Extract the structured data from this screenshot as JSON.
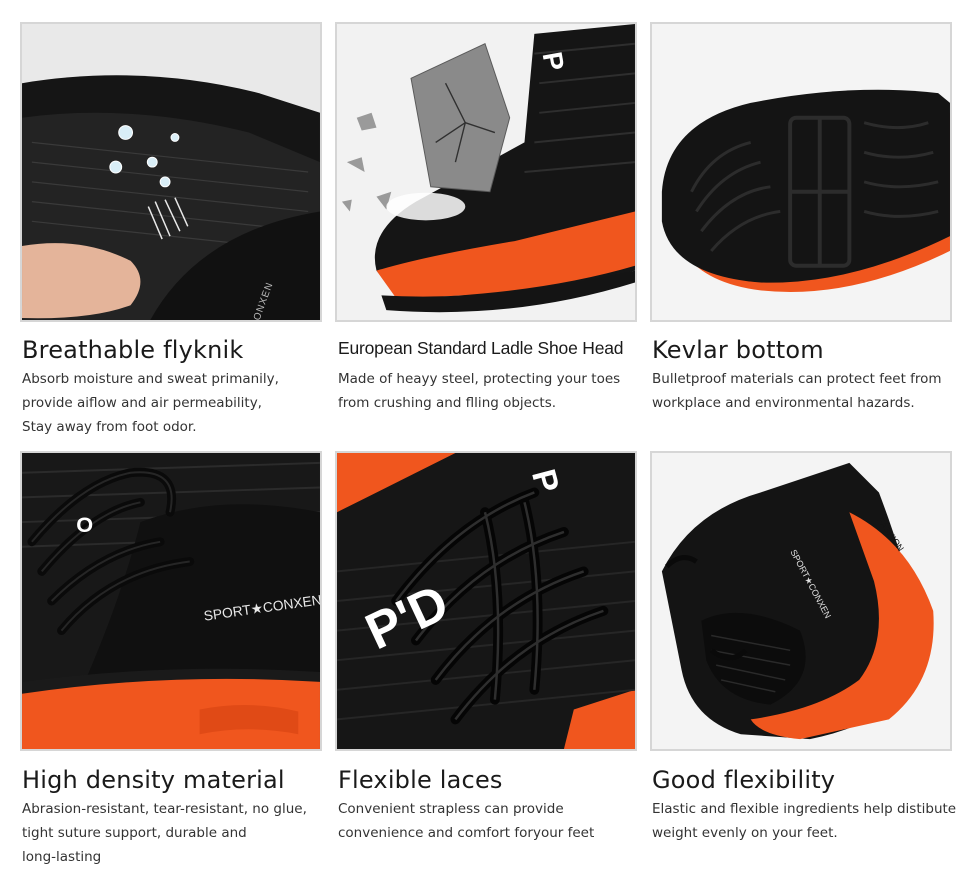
{
  "colors": {
    "accent": "#f0561e",
    "shoe_black": "#141414",
    "panel_border": "#d6d6d6"
  },
  "features": [
    {
      "title": "Breathable flyknik",
      "lines": [
        "Absorb moisture and sweat primanily,",
        "provide aiflow and air permeability,",
        "Stay away from foot odor."
      ]
    },
    {
      "title": "European Standard Ladle Shoe Head",
      "lines": [
        "Made of heayy steel, protecting your toes",
        "from crushing and flling objects."
      ]
    },
    {
      "title": "Kevlar bottom",
      "lines": [
        "Bulletproof materials can protect feet from",
        "workplace and environmental hazards."
      ]
    },
    {
      "title": "High density material",
      "lines": [
        "Abrasion-resistant, tear-resistant, no glue,",
        "tight suture support, durable and",
        "long-lasting"
      ]
    },
    {
      "title": "Flexible laces",
      "lines": [
        "Convenient strapless can provide",
        "convenience and comfort foryour feet"
      ]
    },
    {
      "title": "Good flexibility",
      "lines": [
        "Elastic and flexible ingredients help distibute",
        "weight evenly on your feet."
      ]
    }
  ],
  "shoe_prints": {
    "brand_side": "SPORT★CONXEN",
    "brand_small": "SPORT★CONXEN",
    "heel_tab": "FASHION",
    "insole_text": "CONXEN",
    "side_letters": "P'D"
  }
}
